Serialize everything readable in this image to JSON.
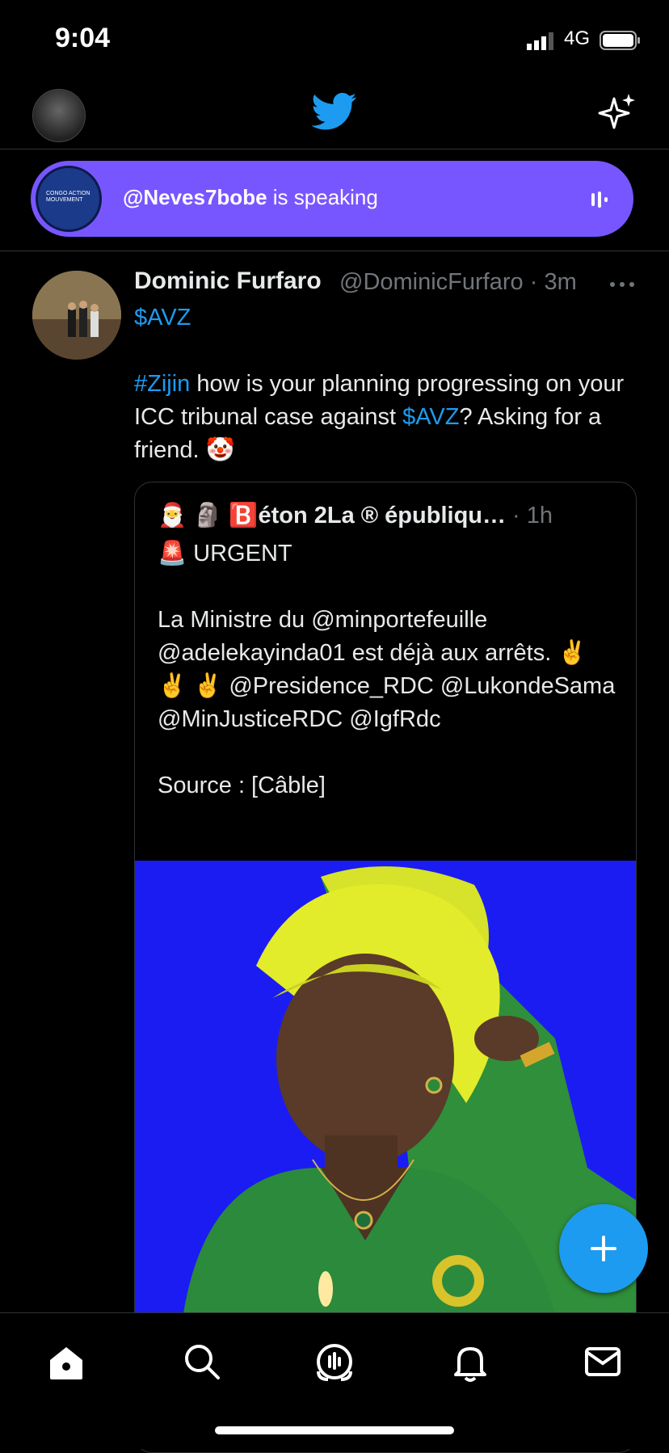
{
  "status": {
    "time": "9:04",
    "network": "4G"
  },
  "spaces": {
    "handle": "@Neves7bobe",
    "suffix": " is speaking",
    "avatar_text": "CONGO ACTION MOUVEMENT"
  },
  "tweet": {
    "author_name": "Dominic Furfaro",
    "author_handle": "@DominicFurfaro",
    "sep": " · ",
    "time": "3m",
    "line1": "$AVZ",
    "hashtag": "#Zijin",
    "body1": " how is your planning progressing on your ICC tribunal case against ",
    "cashtag": "$AVZ",
    "body2": "? Asking for a friend. 🤡"
  },
  "quote": {
    "emojis": "🎅 🗿",
    "name": "🅱️éton 2La ® épubliqu…",
    "sep": " · ",
    "time": "1h",
    "text": "🚨 URGENT\n\nLa Ministre du @minportefeuille @adelekayinda01 est déjà aux arrêts. ✌️ ✌️ ✌️ @Presidence_RDC @LukondeSama @MinJusticeRDC @IgfRdc\n\nSource : [Câble]"
  },
  "colors": {
    "accent": "#1d9bf0",
    "spaces": "#7856ff",
    "background": "#000000",
    "muted": "#71767b"
  },
  "icons": {
    "tabs": [
      "home-icon",
      "search-icon",
      "spaces-icon",
      "notifications-icon",
      "messages-icon"
    ]
  }
}
